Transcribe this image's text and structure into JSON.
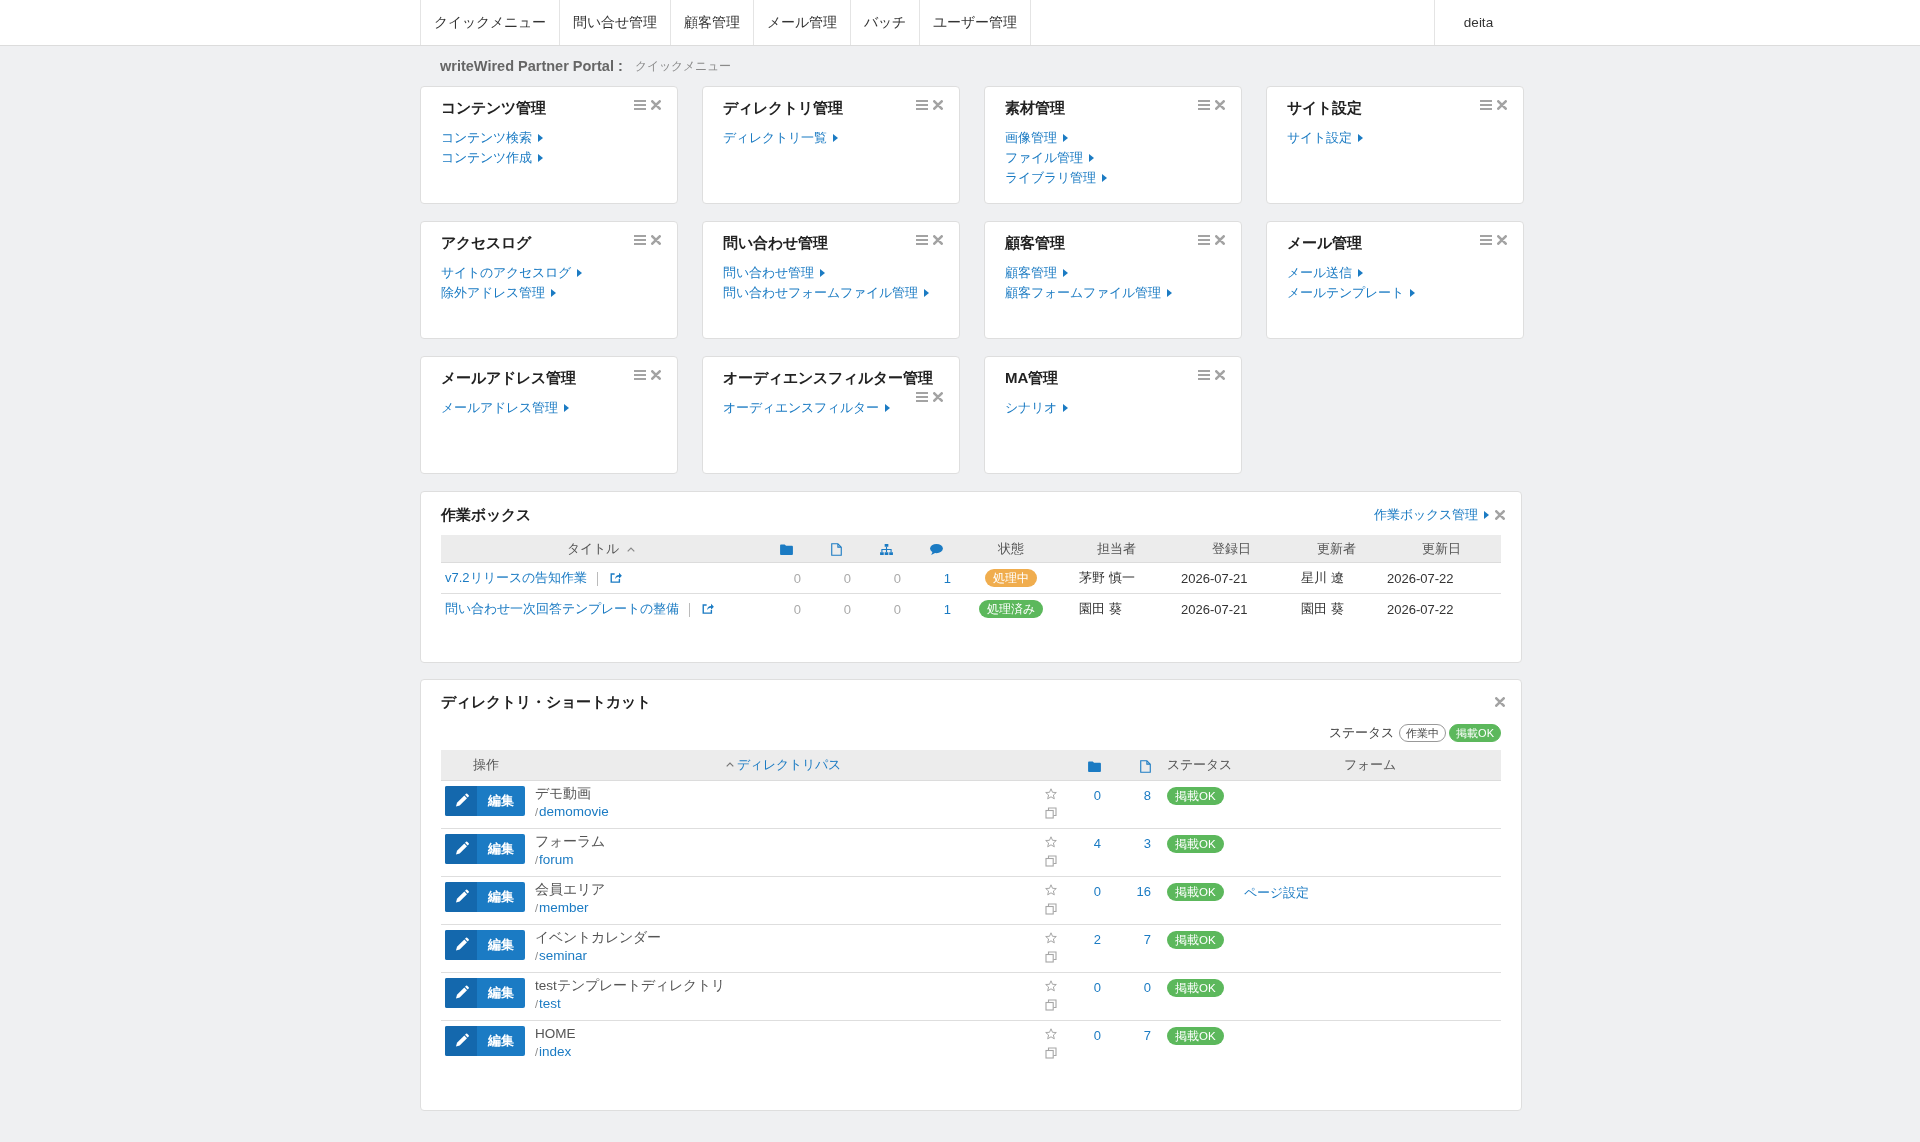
{
  "nav": {
    "items": [
      "クイックメニュー",
      "問い合せ管理",
      "顧客管理",
      "メール管理",
      "バッチ",
      "ユーザー管理"
    ],
    "user": "deita"
  },
  "breadcrumb": {
    "site": "writeWired Partner Portal :",
    "page": "クイックメニュー"
  },
  "cards": [
    {
      "title": "コンテンツ管理",
      "links": [
        "コンテンツ検索",
        "コンテンツ作成"
      ]
    },
    {
      "title": "ディレクトリ管理",
      "links": [
        "ディレクトリ一覧"
      ]
    },
    {
      "title": "素材管理",
      "links": [
        "画像管理",
        "ファイル管理",
        "ライブラリ管理"
      ]
    },
    {
      "title": "サイト設定",
      "links": [
        "サイト設定"
      ]
    },
    {
      "title": "アクセスログ",
      "links": [
        "サイトのアクセスログ",
        "除外アドレス管理"
      ]
    },
    {
      "title": "問い合わせ管理",
      "links": [
        "問い合わせ管理",
        "問い合わせフォームファイル管理"
      ]
    },
    {
      "title": "顧客管理",
      "links": [
        "顧客管理",
        "顧客フォームファイル管理"
      ]
    },
    {
      "title": "メール管理",
      "links": [
        "メール送信",
        "メールテンプレート"
      ]
    },
    {
      "title": "メールアドレス管理",
      "links": [
        "メールアドレス管理"
      ]
    },
    {
      "title": "オーディエンスフィルター管理",
      "links": [
        "オーディエンスフィルター"
      ]
    },
    {
      "title": "MA管理",
      "links": [
        "シナリオ"
      ]
    }
  ],
  "workbox": {
    "title": "作業ボックス",
    "manage_link": "作業ボックス管理",
    "columns": [
      {
        "label": "タイトル",
        "sorted_ascending": true
      },
      {
        "label": "状態"
      },
      {
        "label": "担当者"
      },
      {
        "label": "登録日"
      },
      {
        "label": "更新者"
      },
      {
        "label": "更新日"
      }
    ],
    "rows": [
      {
        "title": "v7.2リリースの告知作業",
        "counts": [
          {
            "value": "0",
            "link": false
          },
          {
            "value": "0",
            "link": false
          },
          {
            "value": "0",
            "link": false
          },
          {
            "value": "1",
            "link": true
          }
        ],
        "status": {
          "label": "処理中",
          "color": "#f0ad4e"
        },
        "assignee": "茅野 慎一",
        "registered": "2026-07-21",
        "updater": "星川 遼",
        "updated": "2026-07-22"
      },
      {
        "title": "問い合わせ一次回答テンプレートの整備",
        "counts": [
          {
            "value": "0",
            "link": false
          },
          {
            "value": "0",
            "link": false
          },
          {
            "value": "0",
            "link": false
          },
          {
            "value": "1",
            "link": true
          }
        ],
        "status": {
          "label": "処理済み",
          "color": "#5cb85c"
        },
        "assignee": "園田 葵",
        "registered": "2026-07-21",
        "updater": "園田 葵",
        "updated": "2026-07-22"
      }
    ]
  },
  "shortcuts": {
    "title": "ディレクトリ・ショートカット",
    "legend": {
      "label": "ステータス",
      "badges": [
        {
          "label": "作業中",
          "kind": "outline"
        },
        {
          "label": "掲載OK",
          "kind": "solid",
          "color": "#5cb85c"
        }
      ]
    },
    "columns": [
      {
        "label": "操作"
      },
      {
        "label": "ディレクトリパス",
        "sorted_ascending": true,
        "link": true
      },
      {
        "label": "ステータス"
      },
      {
        "label": "フォーム"
      }
    ],
    "rows": [
      {
        "action": "編集",
        "name": "デモ動画",
        "path_prefix": "/",
        "path": "demomovie",
        "favorite": false,
        "folders": "0",
        "files": "8",
        "status": {
          "label": "掲載OK",
          "color": "#5cb85c"
        }
      },
      {
        "action": "編集",
        "name": "フォーラム",
        "path_prefix": "/",
        "path": "forum",
        "favorite": false,
        "folders": "4",
        "files": "3",
        "status": {
          "label": "掲載OK",
          "color": "#5cb85c"
        }
      },
      {
        "action": "編集",
        "name": "会員エリア",
        "path_prefix": "/",
        "path": "member",
        "favorite": false,
        "folders": "0",
        "files": "16",
        "status": {
          "label": "掲載OK",
          "color": "#5cb85c"
        },
        "form": "ページ設定"
      },
      {
        "action": "編集",
        "name": "イベントカレンダー",
        "path_prefix": "/",
        "path": "seminar",
        "favorite": false,
        "folders": "2",
        "files": "7",
        "status": {
          "label": "掲載OK",
          "color": "#5cb85c"
        }
      },
      {
        "action": "編集",
        "name": "testテンプレートディレクトリ",
        "path_prefix": "/",
        "path": "test",
        "favorite": false,
        "folders": "0",
        "files": "0",
        "status": {
          "label": "掲載OK",
          "color": "#5cb85c"
        }
      },
      {
        "action": "編集",
        "name": "HOME",
        "path_prefix": "/",
        "path": "index",
        "favorite": false,
        "folders": "0",
        "files": "7",
        "status": {
          "label": "掲載OK",
          "color": "#5cb85c"
        }
      }
    ]
  }
}
